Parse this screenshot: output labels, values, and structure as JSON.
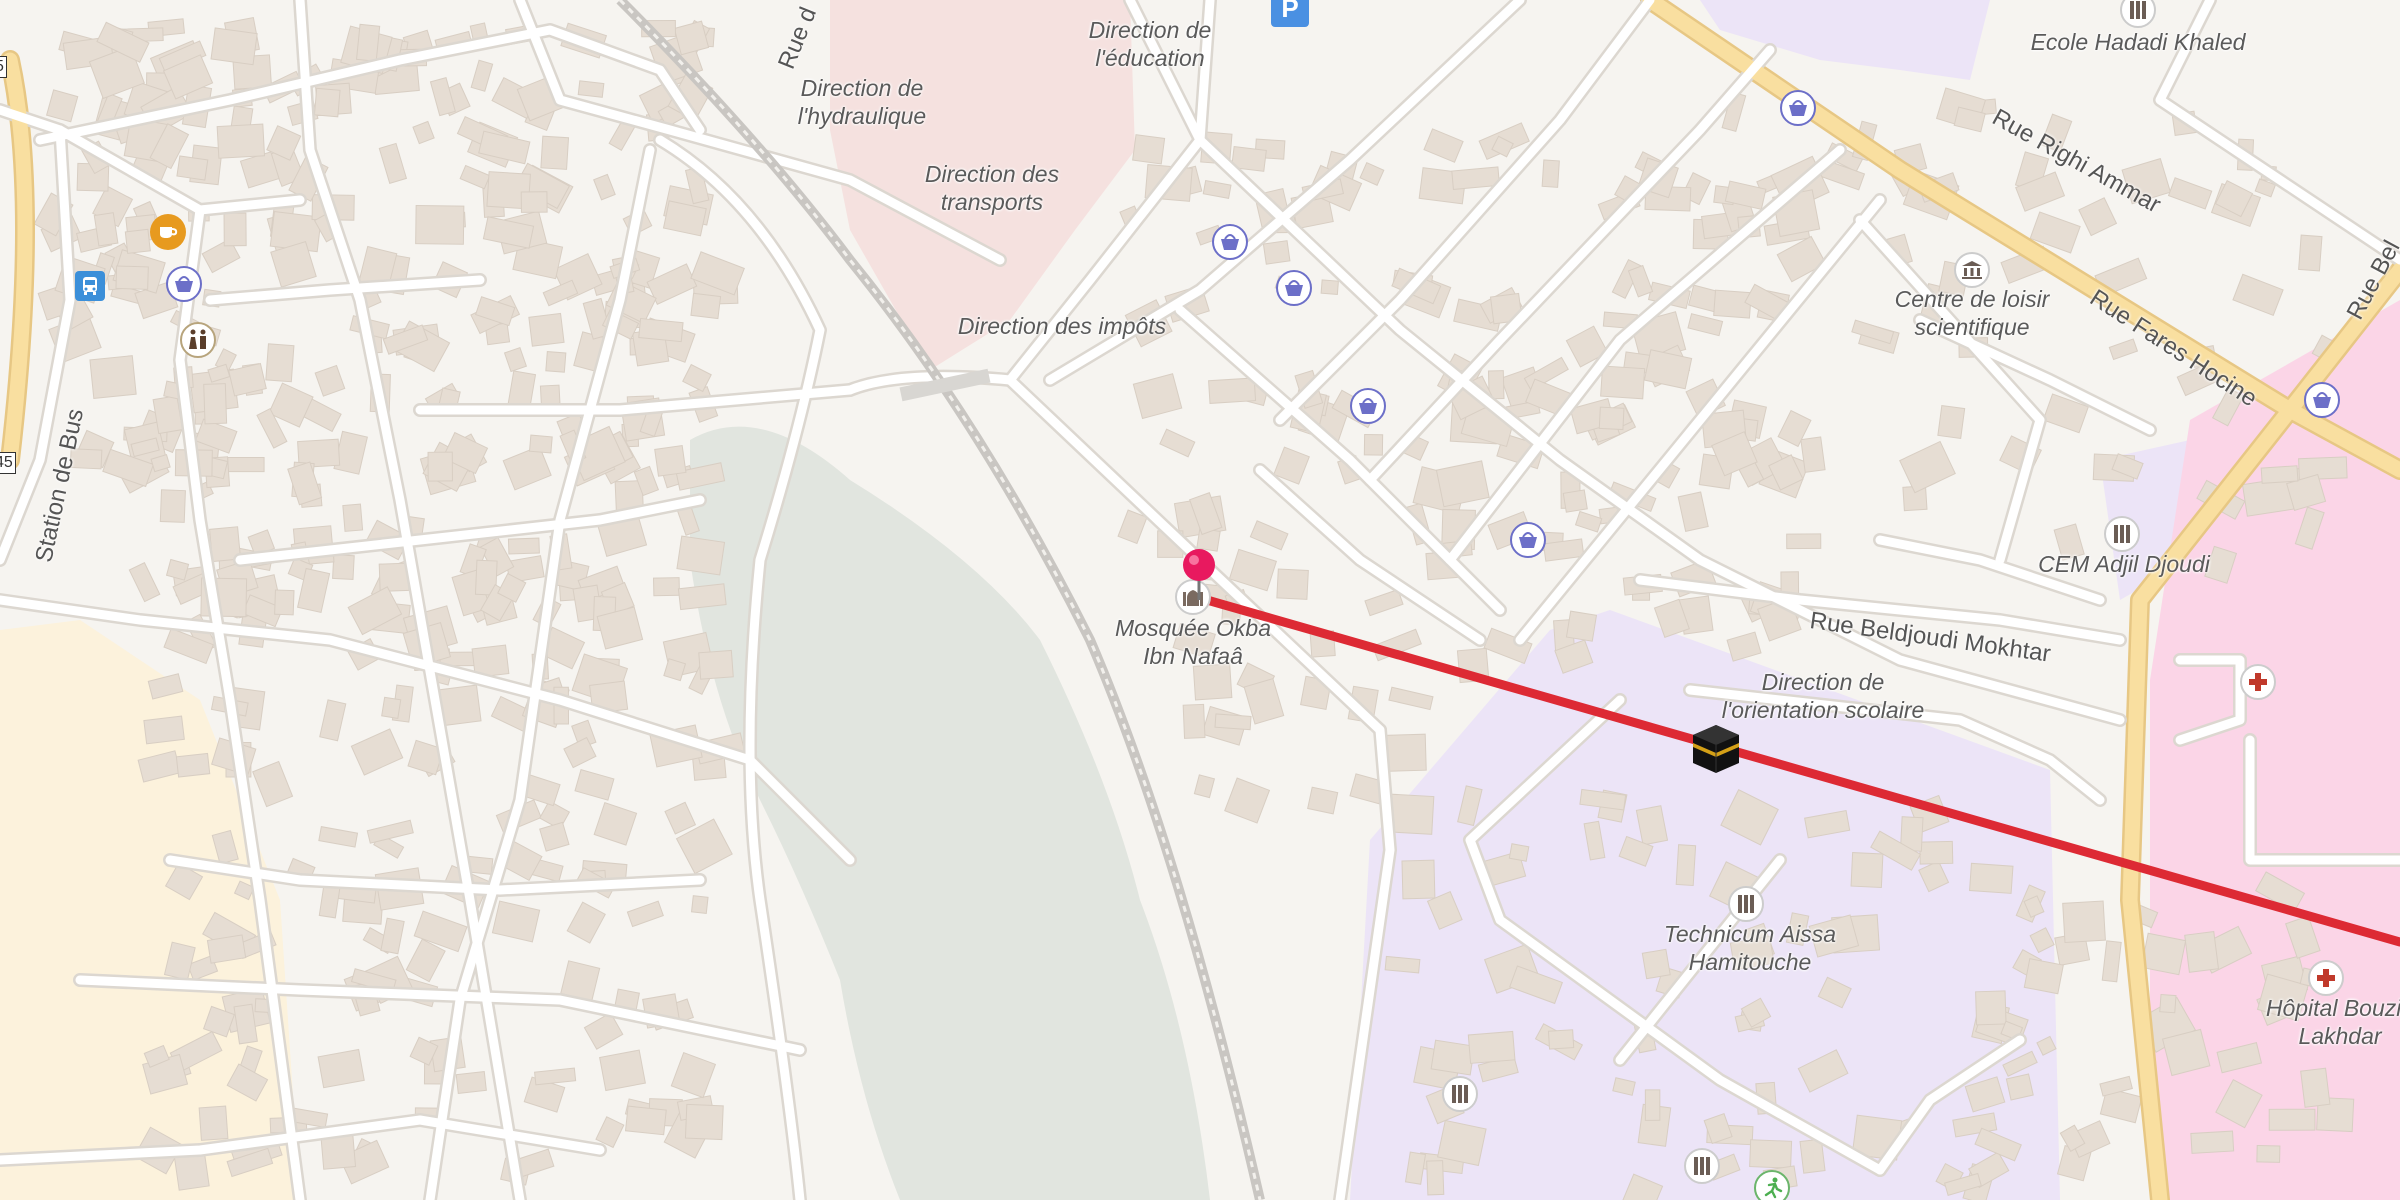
{
  "map": {
    "colors": {
      "background": "#f6f4f0",
      "building": "#e6ddd3",
      "road": "#ffffff",
      "major_road": "#f9dfa0",
      "water": "#e1e5df",
      "government_area": "#f5e1df",
      "school_area": "#ece4f7",
      "hospital_area": "#fbd5e7",
      "sand_area": "#fcf2dc",
      "route_line": "#dd2a34",
      "shop_poi": "#6c6fc8",
      "pin": "#e8195f"
    },
    "labels": {
      "direction_education": "Direction de l'éducation",
      "direction_hydraulique": "Direction de l'hydraulique",
      "direction_transports": "Direction des transports",
      "direction_impots": "Direction des impôts",
      "mosquee": "Mosquée Okba Ibn Nafaâ",
      "direction_orientation": "Direction de l'orientation scolaire",
      "ecole": "Ecole Hadadi Khaled",
      "centre_loisir": "Centre de loisir scientifique",
      "cem": "CEM Adjil Djoudi",
      "technicum": "Technicum Aissa Hamitouche",
      "hopital": "Hôpital Bouzid Lakhdar"
    },
    "streets": {
      "rue_righi": "Rue Righi Ammar",
      "rue_fares": "Rue Fares Hocine",
      "rue_beldjoudi": "Rue Beldjoudi Mokhtar",
      "station_bus": "Station de Bus",
      "rue_top": "Rue d",
      "rue_bel": "Rue Bel"
    },
    "route_numbers": [
      "5",
      "45"
    ],
    "icons": {
      "parking": "parking-icon",
      "shop": "shopping-basket-icon",
      "cafe": "cafe-icon",
      "bus": "bus-icon",
      "toilets": "toilets-icon",
      "mosque": "mosque-icon",
      "kaaba": "kaaba-icon",
      "school": "school-icon",
      "museum": "museum-icon",
      "hospital": "hospital-icon",
      "sport": "sport-icon",
      "pin": "location-pin-icon"
    }
  }
}
